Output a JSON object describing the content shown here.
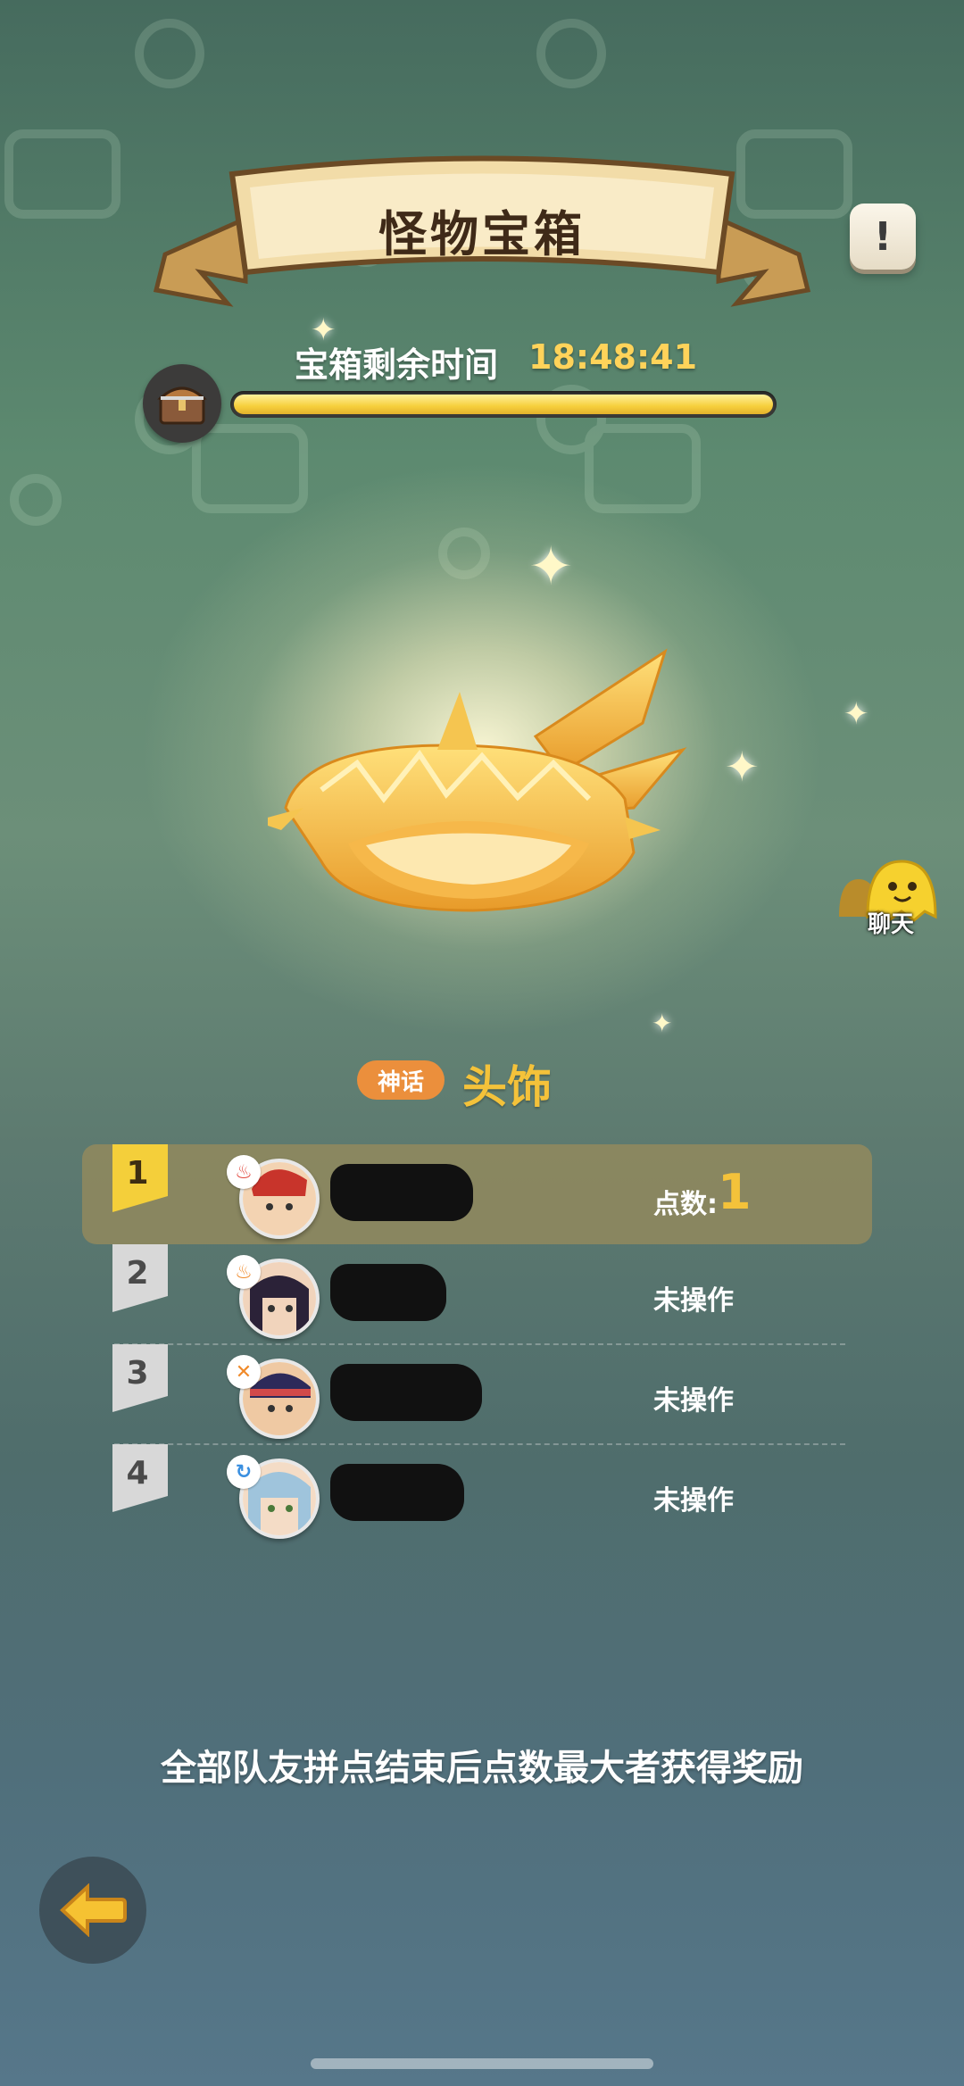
{
  "header": {
    "title": "怪物宝箱",
    "info_label": "!"
  },
  "timer": {
    "label": "宝箱剩余时间",
    "value": "18:48:41",
    "progress": 1.0
  },
  "item": {
    "rarity": "神话",
    "name": "头饰",
    "icon": "golden-crown-icon"
  },
  "chat": {
    "label": "聊天"
  },
  "players": [
    {
      "rank": "1",
      "score_label": "点数:",
      "score": "1",
      "status": "",
      "badge_color": "#e2463c",
      "badge_icon": "fire-icon"
    },
    {
      "rank": "2",
      "score_label": "",
      "score": "",
      "status": "未操作",
      "badge_color": "#f08a2a",
      "badge_icon": "flame-icon"
    },
    {
      "rank": "3",
      "score_label": "",
      "score": "",
      "status": "未操作",
      "badge_color": "#f08a2a",
      "badge_icon": "swords-icon"
    },
    {
      "rank": "4",
      "score_label": "",
      "score": "",
      "status": "未操作",
      "badge_color": "#3a8fe0",
      "badge_icon": "water-icon"
    }
  ],
  "footer": {
    "note": "全部队友拼点结束后点数最大者获得奖励"
  },
  "colors": {
    "accent": "#f4c23a",
    "rarity": "#eb8f3c"
  }
}
